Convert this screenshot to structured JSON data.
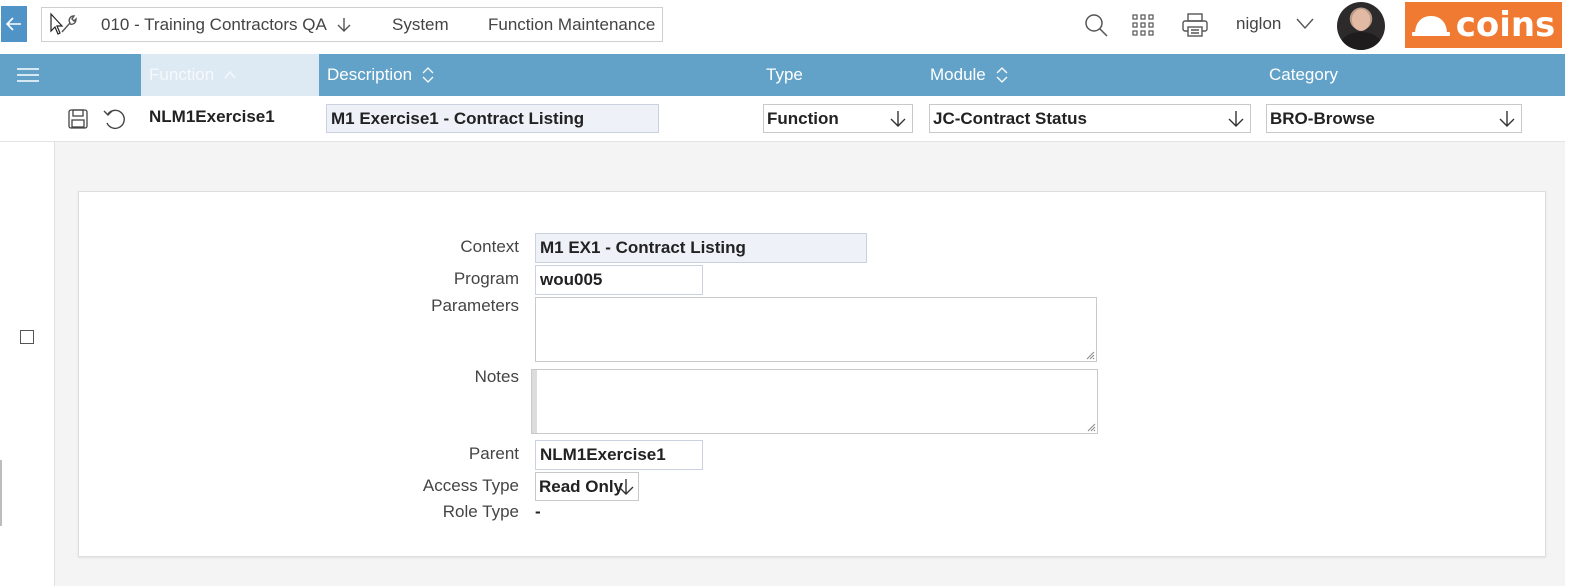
{
  "header": {
    "environment": "010 - Training Contractors QA",
    "breadcrumb_system": "System",
    "breadcrumb_function": "Function Maintenance",
    "username": "niglon",
    "logo_text": "coins",
    "icons": [
      "back-arrow-icon",
      "wrench-icon",
      "search-icon",
      "apps-grid-icon",
      "printer-icon",
      "chevron-down-icon"
    ],
    "colors": {
      "accent": "#4f93c7",
      "header_bar": "#62a2c8",
      "logo_bg": "#f07a32"
    }
  },
  "grid": {
    "columns": {
      "function": "Function",
      "description": "Description",
      "type": "Type",
      "module": "Module",
      "category": "Category"
    },
    "row": {
      "function": "NLM1Exercise1",
      "description": "M1 Exercise1 - Contract Listing",
      "type": "Function",
      "module": "JC-Contract Status",
      "category": "BRO-Browse"
    }
  },
  "detail": {
    "labels": {
      "context": "Context",
      "program": "Program",
      "parameters": "Parameters",
      "notes": "Notes",
      "parent": "Parent",
      "access_type": "Access Type",
      "role_type": "Role Type"
    },
    "values": {
      "context": "M1 EX1 - Contract Listing",
      "program": "wou005",
      "parameters": "",
      "notes": "",
      "parent": "NLM1Exercise1",
      "access_type": "Read Only",
      "role_type": "-"
    }
  }
}
